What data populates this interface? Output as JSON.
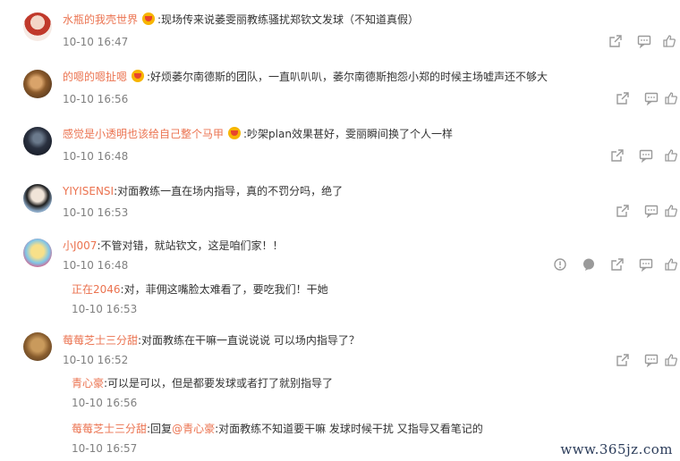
{
  "comments": [
    {
      "user": "水瓶的我壳世界",
      "text": ":现场传来说萎雯丽教练骚扰郑钦文发球（不知道真假）",
      "time": "10-10 16:47"
    },
    {
      "user": "的嗯的嗯扯嗯",
      "text": ":好烦萎尔南德斯的团队，一直叭叭叭，萎尔南德斯抱怨小郑的时候主场嘘声还不够大",
      "time": "10-10 16:56"
    },
    {
      "user": "感觉是小透明也该给自己整个马甲",
      "text": ":吵架plan效果甚好，雯丽瞬间换了个人一样",
      "time": "10-10 16:48"
    },
    {
      "user": "YIYISENSI",
      "text": ":对面教练一直在场内指导，真的不罚分吗，绝了",
      "time": "10-10 16:53"
    },
    {
      "user": "小J007",
      "text": ":不管对错，就站钦文，这是咱们家！！",
      "time": "10-10 16:48"
    },
    {
      "user": "莓莓芝士三分甜",
      "text": ":对面教练在干嘛一直说说说 可以场内指导了？",
      "time": "10-10 16:52"
    }
  ],
  "replies": [
    {
      "user": "正在2046",
      "text": ":对，菲佣这嘴脸太难看了，要吃我们！干她",
      "time": "10-10 16:53"
    },
    {
      "user": "青心豪",
      "text": ":可以是可以，但是都要发球或者打了就别指导了",
      "time": "10-10 16:56"
    },
    {
      "user": "莓莓芝士三分甜",
      "mid": ":回复",
      "mention": "@青心豪",
      "text": ":对面教练不知道要干嘛 发球时候干扰 又指导又看笔记的",
      "time": "10-10 16:57"
    }
  ],
  "watermark": "www.365jz.com",
  "icons": {
    "share": "share-icon",
    "comment": "comment-icon",
    "like": "like-icon",
    "report": "report-icon",
    "bubble": "bubble-icon",
    "badge": "member-badge-icon"
  },
  "colors": {
    "username": "#eb7350",
    "time": "#808080",
    "text": "#333333",
    "icon": "#9a9a9a"
  }
}
